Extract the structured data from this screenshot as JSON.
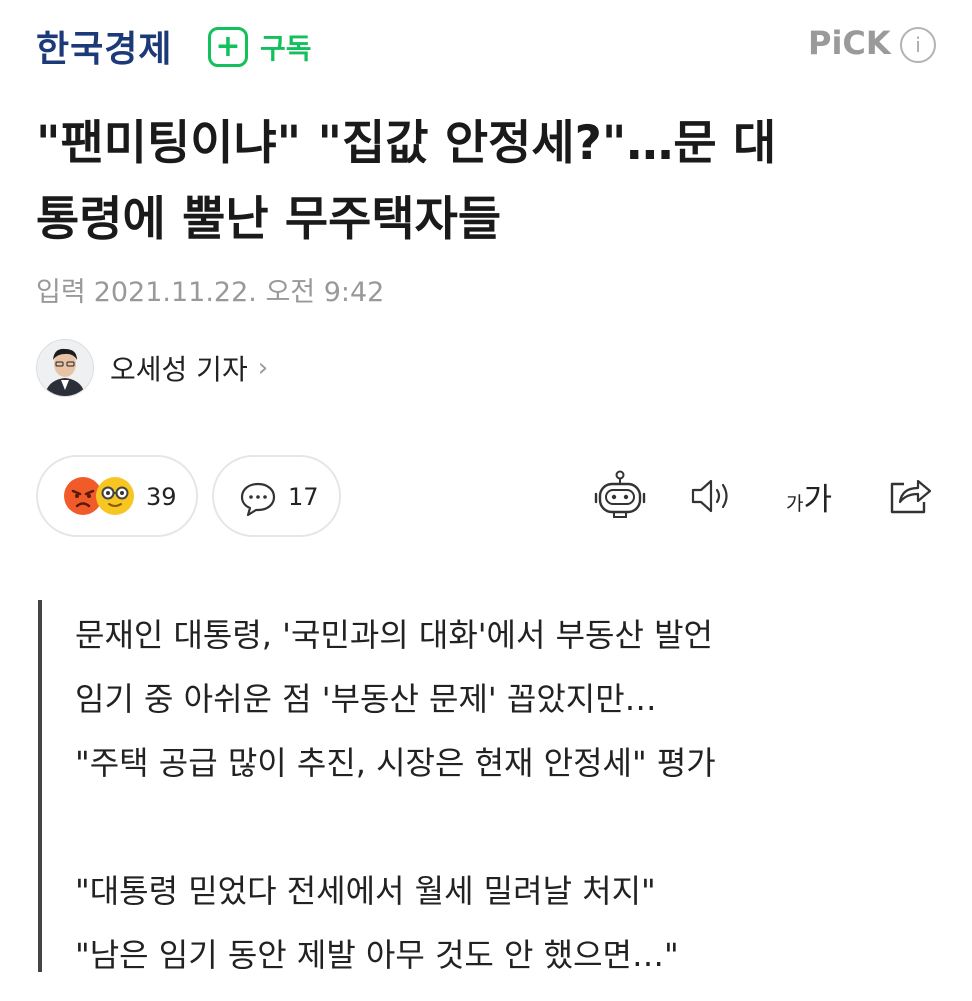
{
  "header": {
    "brand": "한국경제",
    "subscribe_icon": "+",
    "subscribe_label": "구독",
    "pick_label": "PiCK",
    "info_icon": "i"
  },
  "article": {
    "title_lines": [
      "\"팬미팅이냐\" \"집값 안정세?\"…문 대",
      "통령에 뿔난 무주택자들"
    ],
    "date_label": "입력",
    "date": "2021.11.22. 오전 9:42",
    "reporter": "오세성 기자",
    "reporter_chevron": "›"
  },
  "reactions": {
    "count": "39",
    "comments": "17"
  },
  "tools": {
    "font_size_small": "가",
    "font_size_big": "가"
  },
  "summary": {
    "lines": [
      "문재인 대통령, '국민과의 대화'에서 부동산 발언",
      "임기 중 아쉬운 점 '부동산 문제' 꼽았지만…",
      "\"주택 공급 많이 추진, 시장은 현재 안정세\" 평가",
      "",
      "\"대통령 믿었다 전세에서 월세 밀려날 처지\"",
      "\"남은 임기 동안 제발 아무 것도 안 했으면…\""
    ]
  },
  "colors": {
    "brand": "#1d3a78",
    "subscribe_green": "#12c15b",
    "angry_emoji": "#f15a29",
    "nerd_emoji": "#f7c623"
  }
}
